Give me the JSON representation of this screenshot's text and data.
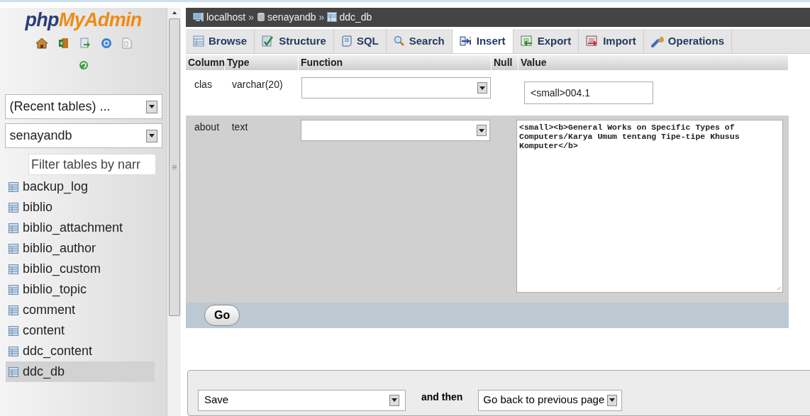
{
  "logo": {
    "parts": [
      "php",
      "MyAdmin"
    ]
  },
  "recent_tables": {
    "value": "(Recent tables) ..."
  },
  "database_select": {
    "value": "senayandb"
  },
  "filter": {
    "placeholder": "Filter tables by narr"
  },
  "tables": [
    {
      "label": "backup_log",
      "selected": false
    },
    {
      "label": "biblio",
      "selected": false
    },
    {
      "label": "biblio_attachment",
      "selected": false
    },
    {
      "label": "biblio_author",
      "selected": false
    },
    {
      "label": "biblio_custom",
      "selected": false
    },
    {
      "label": "biblio_topic",
      "selected": false
    },
    {
      "label": "comment",
      "selected": false
    },
    {
      "label": "content",
      "selected": false
    },
    {
      "label": "ddc_content",
      "selected": false
    },
    {
      "label": "ddc_db",
      "selected": true
    }
  ],
  "breadcrumb": [
    {
      "kind": "server",
      "label": "localhost"
    },
    {
      "kind": "database",
      "label": "senayandb"
    },
    {
      "kind": "table",
      "label": "ddc_db"
    }
  ],
  "breadcrumb_separator": "»",
  "tabs": [
    {
      "kind": "browse",
      "label": "Browse",
      "selected": false
    },
    {
      "kind": "structure",
      "label": "Structure",
      "selected": false
    },
    {
      "kind": "sql",
      "label": "SQL",
      "selected": false
    },
    {
      "kind": "search",
      "label": "Search",
      "selected": false
    },
    {
      "kind": "insert",
      "label": "Insert",
      "selected": true
    },
    {
      "kind": "export",
      "label": "Export",
      "selected": false
    },
    {
      "kind": "import",
      "label": "Import",
      "selected": false
    },
    {
      "kind": "operations",
      "label": "Operations",
      "selected": false
    }
  ],
  "table": {
    "columns": [
      "Column",
      "Type",
      "Function",
      "Null",
      "Value"
    ],
    "rows": [
      {
        "kind": "input",
        "column": "clas",
        "type": "varchar(20)",
        "value": "<small>004.1"
      },
      {
        "kind": "textarea",
        "column": "about",
        "type": "text",
        "value": "<small><b>General Works on Specific Types of Computers/Karya Umum tentang Tipe-tipe Khusus Komputer</b>"
      }
    ]
  },
  "go_button": "Go",
  "footer": {
    "action": "Save",
    "and_then": "and then",
    "after": "Go back to previous page"
  }
}
